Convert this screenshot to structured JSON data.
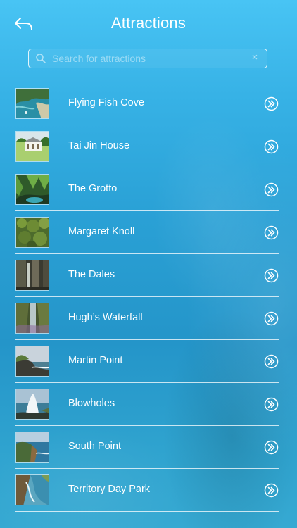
{
  "header": {
    "title": "Attractions",
    "back_icon": "back-arrow-icon"
  },
  "search": {
    "placeholder": "Search for attractions",
    "value": "",
    "clear_icon": "×"
  },
  "colors": {
    "background_top": "#48c4f4",
    "background_bottom": "#2495c9",
    "text": "#ffffff"
  },
  "attractions": [
    {
      "label": "Flying Fish Cove"
    },
    {
      "label": "Tai Jin House"
    },
    {
      "label": "The Grotto"
    },
    {
      "label": "Margaret Knoll"
    },
    {
      "label": "The Dales"
    },
    {
      "label": "Hugh’s Waterfall"
    },
    {
      "label": "Martin Point"
    },
    {
      "label": "Blowholes"
    },
    {
      "label": "South Point"
    },
    {
      "label": "Territory Day Park"
    }
  ]
}
